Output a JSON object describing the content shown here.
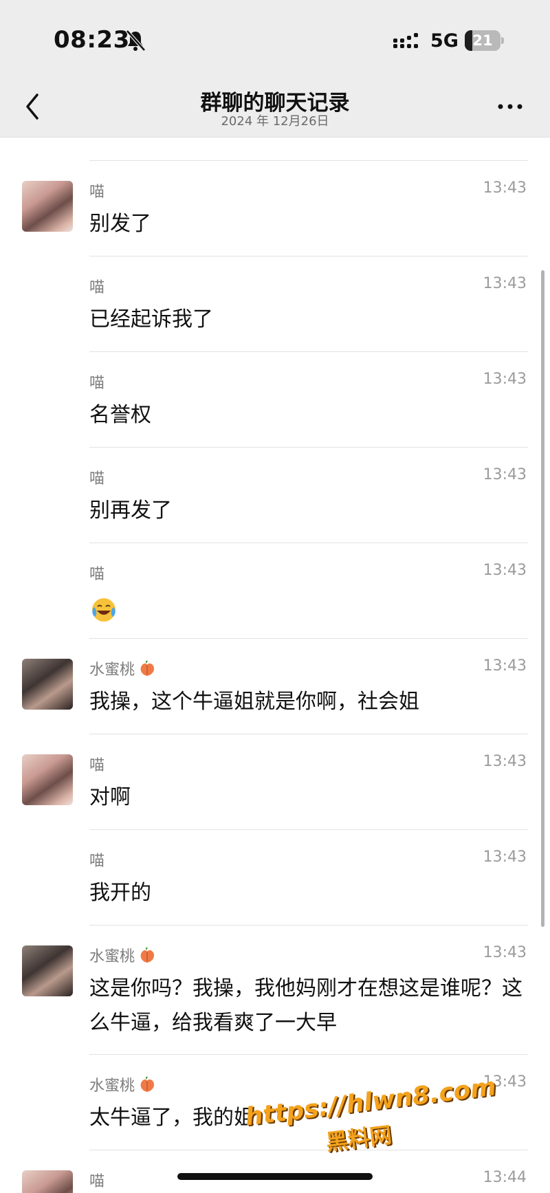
{
  "status_bar": {
    "time": "08:23",
    "network": "5G",
    "battery_level": "21",
    "battery_fraction": 0.21
  },
  "nav": {
    "title": "群聊的聊天记录",
    "subtitle": "2024 年 12月26日"
  },
  "messages": [
    {
      "sender": "喵",
      "time": "13:43",
      "text": "别发了"
    },
    {
      "sender": "喵",
      "time": "13:43",
      "text": "已经起诉我了"
    },
    {
      "sender": "喵",
      "time": "13:43",
      "text": "名誉权"
    },
    {
      "sender": "喵",
      "time": "13:43",
      "text": "别再发了"
    },
    {
      "sender": "喵",
      "time": "13:43",
      "text": ""
    },
    {
      "sender": "水蜜桃",
      "time": "13:43",
      "text": "我操，这个牛逼姐就是你啊，社会姐"
    },
    {
      "sender": "喵",
      "time": "13:43",
      "text": "对啊"
    },
    {
      "sender": "喵",
      "time": "13:43",
      "text": "我开的"
    },
    {
      "sender": "水蜜桃",
      "time": "13:43",
      "text": "这是你吗？我操，我他妈刚才在想这是谁呢？这么牛逼，给我看爽了一大早"
    },
    {
      "sender": "水蜜桃",
      "time": "13:43",
      "text": "太牛逼了，我的姐"
    },
    {
      "sender": "喵",
      "time": "13:44",
      "text": ""
    }
  ],
  "icons": {
    "back": "chevron-left-icon",
    "more": "more-dots-icon",
    "mute": "bell-slash-icon",
    "signal": "signal-bars-icon",
    "peach": "peach-emoji-icon",
    "laugh": "tears-of-joy-emoji-icon"
  },
  "watermark": {
    "url": "https://hlwn8.com",
    "name": "黑料网"
  }
}
